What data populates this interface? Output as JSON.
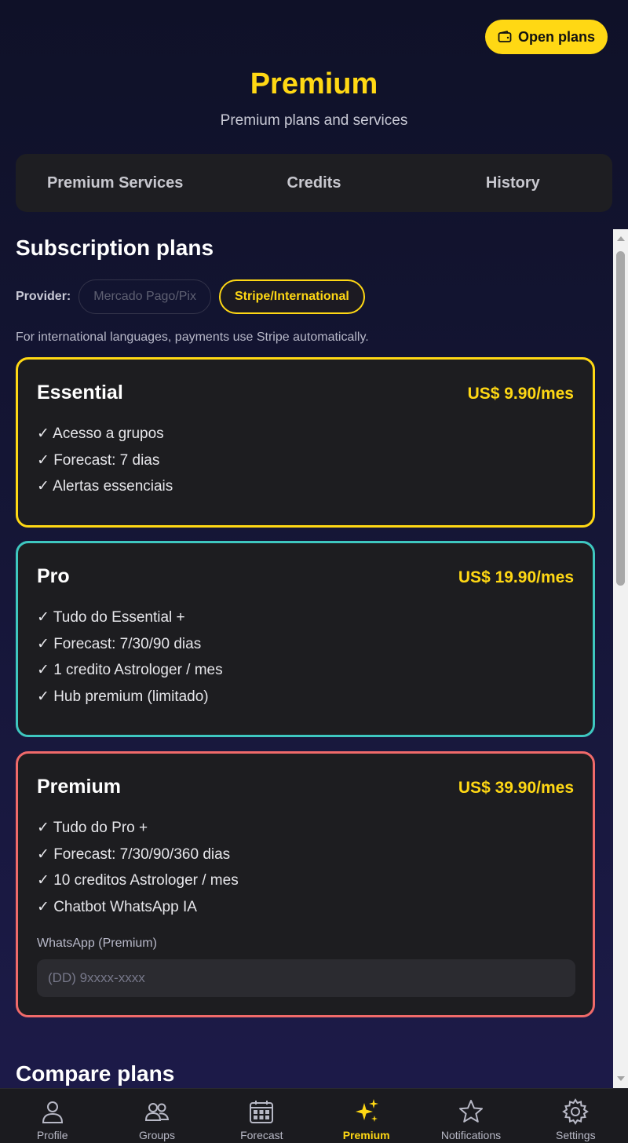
{
  "header": {
    "open_plans_label": "Open plans",
    "title": "Premium",
    "subtitle": "Premium plans and services"
  },
  "tabs": [
    {
      "label": "Premium Services"
    },
    {
      "label": "Credits"
    },
    {
      "label": "History"
    }
  ],
  "subscription": {
    "title": "Subscription plans",
    "provider_label": "Provider:",
    "providers": [
      {
        "label": "Mercado Pago/Pix",
        "selected": false
      },
      {
        "label": "Stripe/International",
        "selected": true
      }
    ],
    "note": "For international languages, payments use Stripe automatically."
  },
  "plans": [
    {
      "name": "Essential",
      "price": "US$ 9.90/mes",
      "border_color": "#ffd814",
      "features": [
        "✓ Acesso a grupos",
        "✓ Forecast: 7 dias",
        "✓ Alertas essenciais"
      ]
    },
    {
      "name": "Pro",
      "price": "US$ 19.90/mes",
      "border_color": "#3ec7c0",
      "features": [
        "✓ Tudo do Essential +",
        "✓ Forecast: 7/30/90 dias",
        "✓ 1 credito Astrologer / mes",
        "✓ Hub premium (limitado)"
      ]
    },
    {
      "name": "Premium",
      "price": "US$ 39.90/mes",
      "border_color": "#f06a6a",
      "features": [
        "✓ Tudo do Pro +",
        "✓ Forecast: 7/30/90/360 dias",
        "✓ 10 creditos Astrologer / mes",
        "✓ Chatbot WhatsApp IA"
      ],
      "whatsapp_label": "WhatsApp (Premium)",
      "whatsapp_placeholder": "(DD) 9xxxx-xxxx",
      "whatsapp_value": ""
    }
  ],
  "compare": {
    "title": "Compare plans"
  },
  "bottom_nav": [
    {
      "label": "Profile",
      "icon": "user-icon",
      "active": false
    },
    {
      "label": "Groups",
      "icon": "groups-icon",
      "active": false
    },
    {
      "label": "Forecast",
      "icon": "calendar-icon",
      "active": false
    },
    {
      "label": "Premium",
      "icon": "sparkles-icon",
      "active": true
    },
    {
      "label": "Notifications",
      "icon": "star-icon",
      "active": false
    },
    {
      "label": "Settings",
      "icon": "gear-icon",
      "active": false
    }
  ],
  "colors": {
    "accent": "#ffd814",
    "background": "#0f1128",
    "card": "#1d1d20"
  }
}
